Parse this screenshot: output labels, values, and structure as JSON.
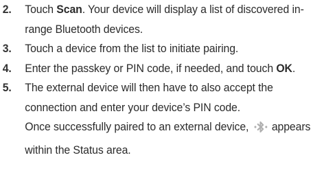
{
  "steps": [
    {
      "number": "2.",
      "text_before": "Touch ",
      "bold": "Scan",
      "text_after": ". Your device will display a list of discovered in-range Bluetooth devices."
    },
    {
      "number": "3.",
      "text": "Touch a device from the list to initiate pairing."
    },
    {
      "number": "4.",
      "text_before": "Enter the passkey or PIN code, if needed, and touch ",
      "bold": "OK",
      "text_after": "."
    },
    {
      "number": "5.",
      "text": "The external device will then have to also accept the connection and enter your device’s PIN code.",
      "followup_before": "Once successfully paired to an external device,",
      "followup_icon": "bluetooth-connected-icon",
      "followup_after": "appears within the Status area."
    }
  ],
  "colors": {
    "text": "#2b2b2b",
    "icon": "#b0b0b0"
  }
}
